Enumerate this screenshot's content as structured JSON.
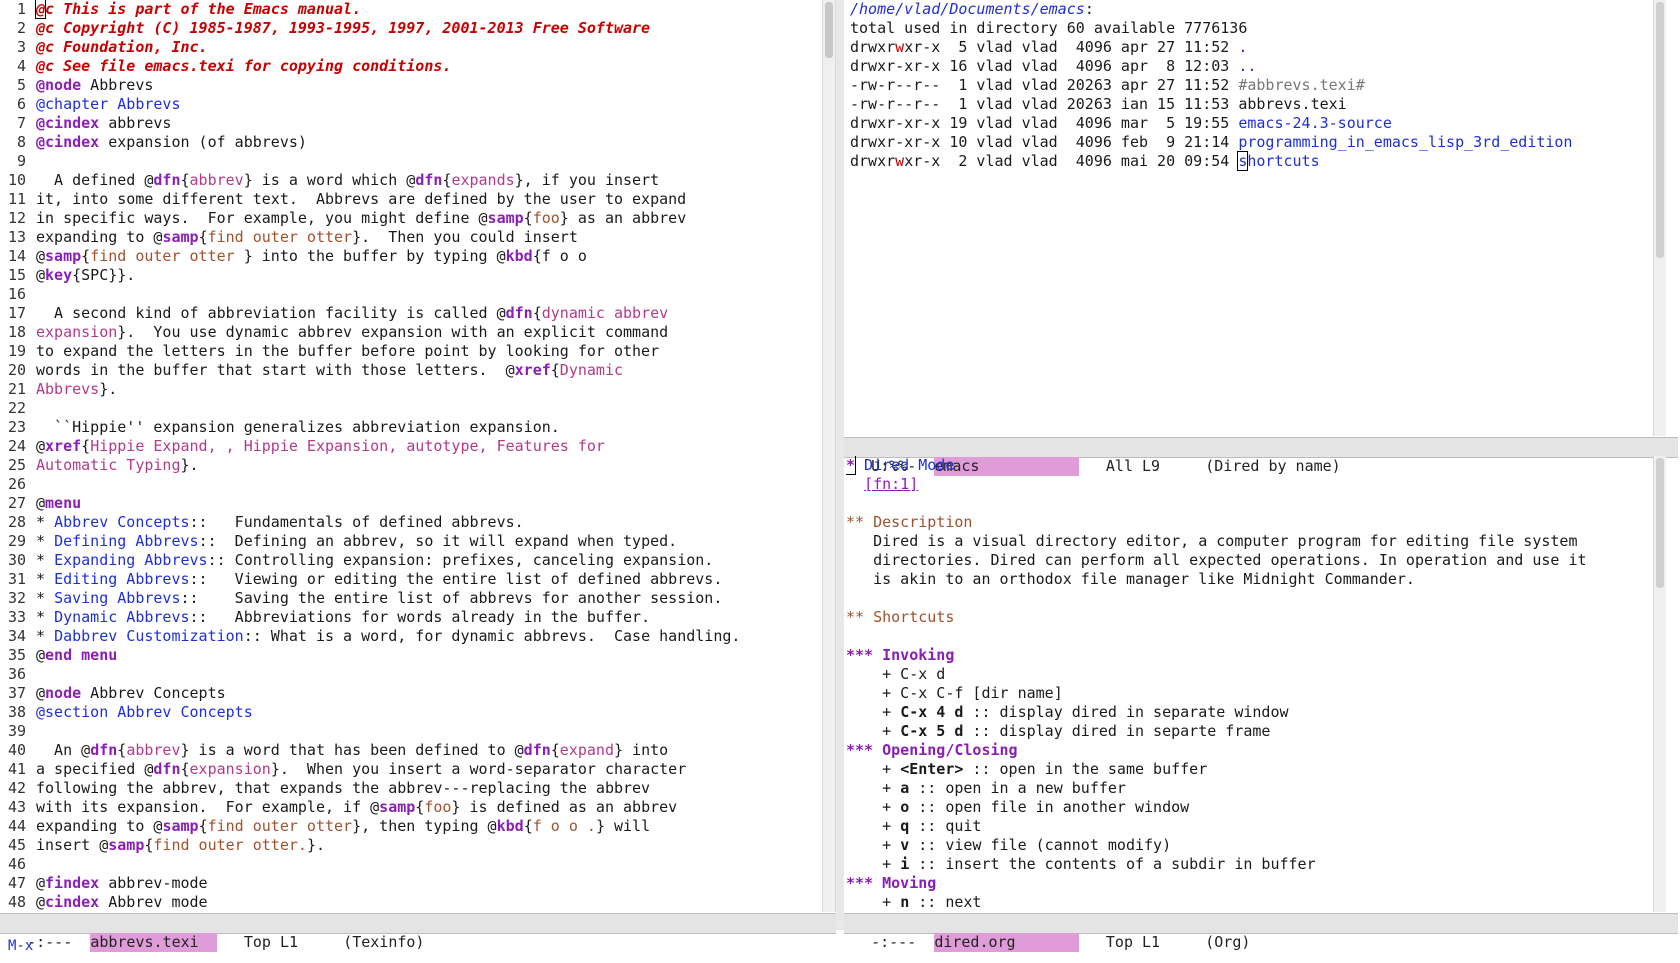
{
  "left_pane": {
    "lines": [
      [
        {
          "t": "@",
          "c": "r cursor"
        },
        {
          "t": "c This is part of the Emacs manual.",
          "c": "r"
        }
      ],
      [
        {
          "t": "@c Copyright (C) 1985-1987, 1993-1995, 1997, 2001-2013 Free Software",
          "c": "r"
        }
      ],
      [
        {
          "t": "@c Foundation, Inc.",
          "c": "r"
        }
      ],
      [
        {
          "t": "@c See file emacs.texi for copying conditions.",
          "c": "r"
        }
      ],
      [
        {
          "t": "@",
          "c": "p"
        },
        {
          "t": "node",
          "c": "p"
        },
        {
          "t": " Abbrevs",
          "c": ""
        }
      ],
      [
        {
          "t": "@chapter Abbrevs",
          "c": "b"
        }
      ],
      [
        {
          "t": "@cindex",
          "c": "p"
        },
        {
          "t": " abbrevs",
          "c": ""
        }
      ],
      [
        {
          "t": "@cindex",
          "c": "p"
        },
        {
          "t": " expansion (of abbrevs)",
          "c": ""
        }
      ],
      [],
      [
        {
          "t": "  A defined @",
          "c": ""
        },
        {
          "t": "dfn",
          "c": "p"
        },
        {
          "t": "{",
          "c": ""
        },
        {
          "t": "abbrev",
          "c": "m"
        },
        {
          "t": "} is a word which @",
          "c": ""
        },
        {
          "t": "dfn",
          "c": "p"
        },
        {
          "t": "{",
          "c": ""
        },
        {
          "t": "expands",
          "c": "m"
        },
        {
          "t": "}, if you insert",
          "c": ""
        }
      ],
      [
        {
          "t": "it, into some different text.  Abbrevs are defined by the user to expand",
          "c": ""
        }
      ],
      [
        {
          "t": "in specific ways.  For example, you might define @",
          "c": ""
        },
        {
          "t": "samp",
          "c": "p"
        },
        {
          "t": "{",
          "c": ""
        },
        {
          "t": "foo",
          "c": "br"
        },
        {
          "t": "} as an abbrev",
          "c": ""
        }
      ],
      [
        {
          "t": "expanding to @",
          "c": ""
        },
        {
          "t": "samp",
          "c": "p"
        },
        {
          "t": "{",
          "c": ""
        },
        {
          "t": "find outer otter",
          "c": "br"
        },
        {
          "t": "}.  Then you could insert",
          "c": ""
        }
      ],
      [
        {
          "t": "@",
          "c": ""
        },
        {
          "t": "samp",
          "c": "p"
        },
        {
          "t": "{",
          "c": ""
        },
        {
          "t": "find outer otter ",
          "c": "br"
        },
        {
          "t": "} into the buffer by typing @",
          "c": ""
        },
        {
          "t": "kbd",
          "c": "p"
        },
        {
          "t": "{f o o",
          "c": ""
        }
      ],
      [
        {
          "t": "@",
          "c": ""
        },
        {
          "t": "key",
          "c": "p"
        },
        {
          "t": "{SPC}}.",
          "c": ""
        }
      ],
      [],
      [
        {
          "t": "  A second kind of abbreviation facility is called @",
          "c": ""
        },
        {
          "t": "dfn",
          "c": "p"
        },
        {
          "t": "{",
          "c": ""
        },
        {
          "t": "dynamic abbrev",
          "c": "m"
        }
      ],
      [
        {
          "t": "expansion",
          "c": "m"
        },
        {
          "t": "}.  You use dynamic abbrev expansion with an explicit command",
          "c": ""
        }
      ],
      [
        {
          "t": "to expand the letters in the buffer before point by looking for other",
          "c": ""
        }
      ],
      [
        {
          "t": "words in the buffer that start with those letters.  @",
          "c": ""
        },
        {
          "t": "xref",
          "c": "p"
        },
        {
          "t": "{",
          "c": ""
        },
        {
          "t": "Dynamic",
          "c": "m"
        }
      ],
      [
        {
          "t": "Abbrevs",
          "c": "m"
        },
        {
          "t": "}.",
          "c": ""
        }
      ],
      [],
      [
        {
          "t": "  ``Hippie'' expansion generalizes abbreviation expansion.",
          "c": ""
        }
      ],
      [
        {
          "t": "@",
          "c": ""
        },
        {
          "t": "xref",
          "c": "p"
        },
        {
          "t": "{",
          "c": ""
        },
        {
          "t": "Hippie Expand, , Hippie Expansion, autotype, Features for",
          "c": "m"
        }
      ],
      [
        {
          "t": "Automatic Typing",
          "c": "m"
        },
        {
          "t": "}.",
          "c": ""
        }
      ],
      [],
      [
        {
          "t": "@",
          "c": ""
        },
        {
          "t": "menu",
          "c": "p"
        }
      ],
      [
        {
          "t": "* ",
          "c": ""
        },
        {
          "t": "Abbrev Concepts",
          "c": "b"
        },
        {
          "t": "::   Fundamentals of defined abbrevs.",
          "c": ""
        }
      ],
      [
        {
          "t": "* ",
          "c": ""
        },
        {
          "t": "Defining Abbrevs",
          "c": "b"
        },
        {
          "t": "::  Defining an abbrev, so it will expand when typed.",
          "c": ""
        }
      ],
      [
        {
          "t": "* ",
          "c": ""
        },
        {
          "t": "Expanding Abbrevs",
          "c": "b"
        },
        {
          "t": ":: Controlling expansion: prefixes, canceling expansion.",
          "c": ""
        }
      ],
      [
        {
          "t": "* ",
          "c": ""
        },
        {
          "t": "Editing Abbrevs",
          "c": "b"
        },
        {
          "t": "::   Viewing or editing the entire list of defined abbrevs.",
          "c": ""
        }
      ],
      [
        {
          "t": "* ",
          "c": ""
        },
        {
          "t": "Saving Abbrevs",
          "c": "b"
        },
        {
          "t": "::    Saving the entire list of abbrevs for another session.",
          "c": ""
        }
      ],
      [
        {
          "t": "* ",
          "c": ""
        },
        {
          "t": "Dynamic Abbrevs",
          "c": "b"
        },
        {
          "t": "::   Abbreviations for words already in the buffer.",
          "c": ""
        }
      ],
      [
        {
          "t": "* ",
          "c": ""
        },
        {
          "t": "Dabbrev Customization",
          "c": "b"
        },
        {
          "t": ":: What is a word, for dynamic abbrevs.  Case handling.",
          "c": ""
        }
      ],
      [
        {
          "t": "@",
          "c": ""
        },
        {
          "t": "end menu",
          "c": "p"
        }
      ],
      [],
      [
        {
          "t": "@",
          "c": ""
        },
        {
          "t": "node",
          "c": "p"
        },
        {
          "t": " Abbrev Concepts",
          "c": ""
        }
      ],
      [
        {
          "t": "@section Abbrev Concepts",
          "c": "b"
        }
      ],
      [],
      [
        {
          "t": "  An @",
          "c": ""
        },
        {
          "t": "dfn",
          "c": "p"
        },
        {
          "t": "{",
          "c": ""
        },
        {
          "t": "abbrev",
          "c": "m"
        },
        {
          "t": "} is a word that has been defined to @",
          "c": ""
        },
        {
          "t": "dfn",
          "c": "p"
        },
        {
          "t": "{",
          "c": ""
        },
        {
          "t": "expand",
          "c": "m"
        },
        {
          "t": "} into",
          "c": ""
        }
      ],
      [
        {
          "t": "a specified @",
          "c": ""
        },
        {
          "t": "dfn",
          "c": "p"
        },
        {
          "t": "{",
          "c": ""
        },
        {
          "t": "expansion",
          "c": "m"
        },
        {
          "t": "}.  When you insert a word-separator character",
          "c": ""
        }
      ],
      [
        {
          "t": "following the abbrev, that expands the abbrev---replacing the abbrev",
          "c": ""
        }
      ],
      [
        {
          "t": "with its expansion.  For example, if @",
          "c": ""
        },
        {
          "t": "samp",
          "c": "p"
        },
        {
          "t": "{",
          "c": ""
        },
        {
          "t": "foo",
          "c": "br"
        },
        {
          "t": "} is defined as an abbrev",
          "c": ""
        }
      ],
      [
        {
          "t": "expanding to @",
          "c": ""
        },
        {
          "t": "samp",
          "c": "p"
        },
        {
          "t": "{",
          "c": ""
        },
        {
          "t": "find outer otter",
          "c": "br"
        },
        {
          "t": "}, then typing @",
          "c": ""
        },
        {
          "t": "kbd",
          "c": "p"
        },
        {
          "t": "{",
          "c": ""
        },
        {
          "t": "f o o .",
          "c": "br"
        },
        {
          "t": "} will",
          "c": ""
        }
      ],
      [
        {
          "t": "insert @",
          "c": ""
        },
        {
          "t": "samp",
          "c": "p"
        },
        {
          "t": "{",
          "c": ""
        },
        {
          "t": "find outer otter.",
          "c": "br"
        },
        {
          "t": "}.",
          "c": ""
        }
      ],
      [],
      [
        {
          "t": "@",
          "c": ""
        },
        {
          "t": "findex",
          "c": "p"
        },
        {
          "t": " abbrev-mode",
          "c": ""
        }
      ],
      [
        {
          "t": "@",
          "c": ""
        },
        {
          "t": "cindex",
          "c": "p"
        },
        {
          "t": " Abbrev mode",
          "c": ""
        }
      ]
    ]
  },
  "dired": {
    "path": "/home/vlad/Documents/emacs",
    "path_suffix": ":",
    "summary": "total used in directory 60 available 7776136",
    "entries": [
      {
        "perm_a": "drwxr",
        "perm_w": "w",
        "perm_b": "xr-x",
        "rest": "  5 vlad vlad  4096 apr 27 11:52 ",
        "name": ".",
        "kind": "dir"
      },
      {
        "perm_a": "drwxr-xr-x",
        "perm_w": "",
        "perm_b": "",
        "rest": " 16 vlad vlad  4096 apr  8 12:03 ",
        "name": "..",
        "kind": "dir"
      },
      {
        "perm_a": "-rw-r--r--",
        "perm_w": "",
        "perm_b": "",
        "rest": "  1 vlad vlad 20263 apr 27 11:52 ",
        "name": "#abbrevs.texi#",
        "kind": "tmp"
      },
      {
        "perm_a": "-rw-r--r--",
        "perm_w": "",
        "perm_b": "",
        "rest": "  1 vlad vlad 20263 ian 15 11:53 ",
        "name": "abbrevs.texi",
        "kind": "file"
      },
      {
        "perm_a": "drwxr-xr-x",
        "perm_w": "",
        "perm_b": "",
        "rest": " 19 vlad vlad  4096 mar  5 19:55 ",
        "name": "emacs-24.3-source",
        "kind": "dir"
      },
      {
        "perm_a": "drwxr-xr-x",
        "perm_w": "",
        "perm_b": "",
        "rest": " 10 vlad vlad  4096 feb  9 21:14 ",
        "name": "programming_in_emacs_lisp_3rd_edition",
        "kind": "dir"
      },
      {
        "perm_a": "drwxr",
        "perm_w": "w",
        "perm_b": "xr-x",
        "rest": "  2 vlad vlad  4096 mai 20 09:54 ",
        "name": "shortcuts",
        "kind": "dir"
      }
    ]
  },
  "org": {
    "lines": [
      [
        {
          "t": "*",
          "c": "ostar cursor"
        },
        {
          "t": " Dired Mode",
          "c": "b"
        }
      ],
      [
        {
          "t": "  ",
          "c": ""
        },
        {
          "t": "[fn:1]",
          "c": "olink"
        }
      ],
      [],
      [
        {
          "t": "** ",
          "c": "o2"
        },
        {
          "t": "Description",
          "c": "o2"
        }
      ],
      [
        {
          "t": "   Dired is a visual directory editor, a computer program for editing file system",
          "c": ""
        }
      ],
      [
        {
          "t": "   directories. Dired can perform all expected operations. In operation and use it",
          "c": ""
        }
      ],
      [
        {
          "t": "   is akin to an orthodox file manager like Midnight Commander.",
          "c": ""
        }
      ],
      [],
      [
        {
          "t": "** ",
          "c": "o2"
        },
        {
          "t": "Shortcuts",
          "c": "o2"
        }
      ],
      [],
      [
        {
          "t": "*** Invoking",
          "c": "ostar"
        }
      ],
      [
        {
          "t": "    + C-x d",
          "c": ""
        }
      ],
      [
        {
          "t": "    + C-x C-f [dir name]",
          "c": ""
        }
      ],
      [
        {
          "t": "    + ",
          "c": ""
        },
        {
          "t": "C-x 4 d",
          "c": "bold"
        },
        {
          "t": " :: display dired in separate window",
          "c": ""
        }
      ],
      [
        {
          "t": "    + ",
          "c": ""
        },
        {
          "t": "C-x 5 d",
          "c": "bold"
        },
        {
          "t": " :: display dired in separte frame",
          "c": ""
        }
      ],
      [
        {
          "t": "*** Opening/Closing",
          "c": "ostar"
        }
      ],
      [
        {
          "t": "    + ",
          "c": ""
        },
        {
          "t": "<Enter>",
          "c": "bold"
        },
        {
          "t": " :: open in the same buffer",
          "c": ""
        }
      ],
      [
        {
          "t": "    + ",
          "c": ""
        },
        {
          "t": "a",
          "c": "bold"
        },
        {
          "t": " :: open in a new buffer",
          "c": ""
        }
      ],
      [
        {
          "t": "    + ",
          "c": ""
        },
        {
          "t": "o",
          "c": "bold"
        },
        {
          "t": " :: open file in another window",
          "c": ""
        }
      ],
      [
        {
          "t": "    + ",
          "c": ""
        },
        {
          "t": "q",
          "c": "bold"
        },
        {
          "t": " :: quit",
          "c": ""
        }
      ],
      [
        {
          "t": "    + ",
          "c": ""
        },
        {
          "t": "v",
          "c": "bold"
        },
        {
          "t": " :: view file (cannot modify)",
          "c": ""
        }
      ],
      [
        {
          "t": "    + ",
          "c": ""
        },
        {
          "t": "i",
          "c": "bold"
        },
        {
          "t": " :: insert the contents of a subdir in buffer",
          "c": ""
        }
      ],
      [
        {
          "t": "*** Moving",
          "c": "ostar"
        }
      ],
      [
        {
          "t": "    + ",
          "c": ""
        },
        {
          "t": "n",
          "c": "bold"
        },
        {
          "t": " :: next",
          "c": ""
        }
      ]
    ]
  },
  "modelines": {
    "left": {
      "status": " -:---  ",
      "buffer": "abbrevs.texi",
      "buffer_pad": "  ",
      "pos": "   Top L1     ",
      "mode": "(Texinfo)"
    },
    "dired": {
      "status": " U:%%-  ",
      "buffer": "emacs",
      "buffer_pad": "           ",
      "pos": "   All L9     ",
      "mode": "(Dired by name)"
    },
    "org": {
      "status": " -:---  ",
      "buffer": "dired.org",
      "buffer_pad": "       ",
      "pos": "   Top L1     ",
      "mode": "(Org)"
    }
  },
  "minibuffer": {
    "text": "M-x"
  }
}
